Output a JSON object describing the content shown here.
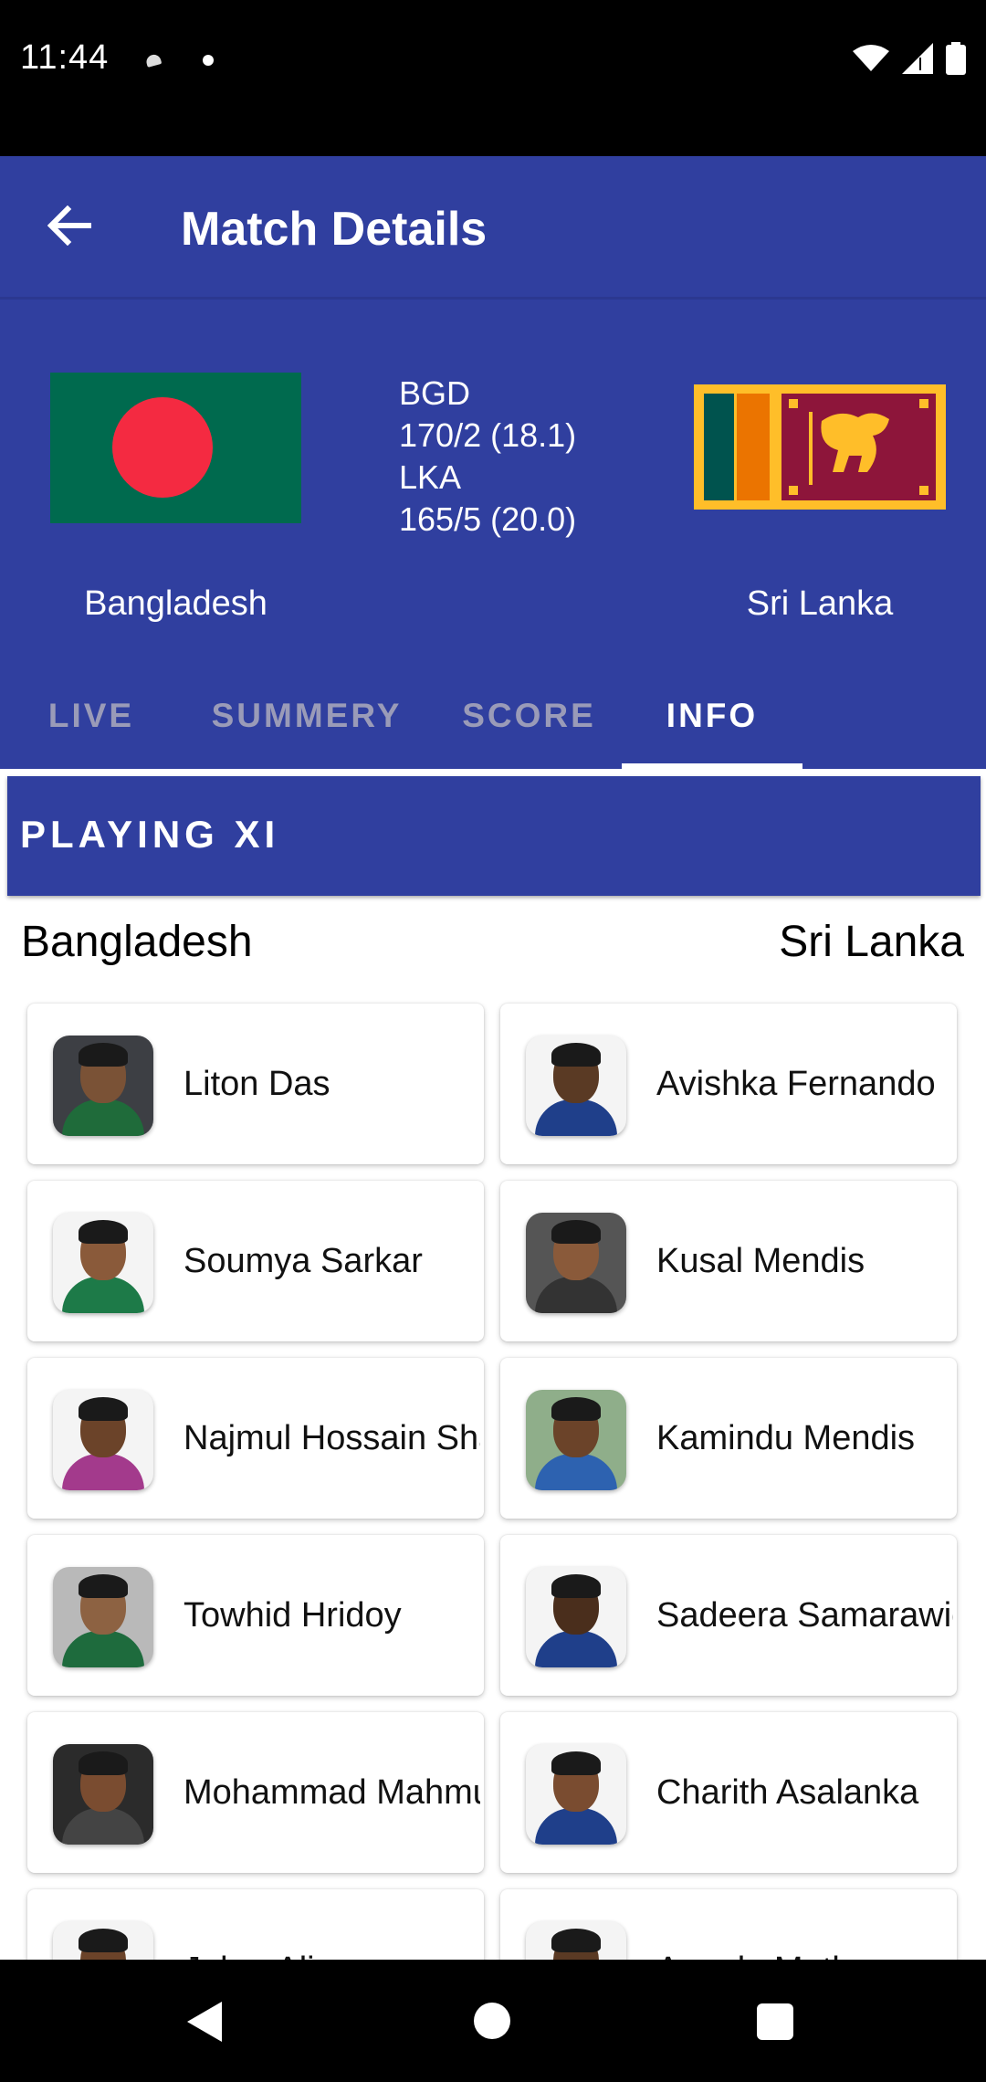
{
  "status_bar": {
    "time": "11:44"
  },
  "toolbar": {
    "title": "Match Details"
  },
  "match": {
    "team1": {
      "name": "Bangladesh",
      "code": "BGD",
      "score": "170/2 (18.1)"
    },
    "team2": {
      "name": "Sri Lanka",
      "code": "LKA",
      "score": "165/5 (20.0)"
    }
  },
  "tabs": [
    {
      "label": "LIVE",
      "active": false
    },
    {
      "label": "SUMMERY",
      "active": false
    },
    {
      "label": "SCORE",
      "active": false
    },
    {
      "label": "INFO",
      "active": true
    }
  ],
  "section": {
    "title": "PLAYING XI"
  },
  "columns": {
    "left": "Bangladesh",
    "right": "Sri Lanka"
  },
  "players_left": [
    "Liton Das",
    "Soumya Sarkar",
    "Najmul Hossain\nShanto",
    "Towhid Hridoy",
    "Mohammad\nMahmudullah",
    "Jaker Ali"
  ],
  "players_right": [
    "Avishka Fernando",
    "Kusal Mendis",
    "Kamindu Mendis",
    "Sadeera\nSamarawickrama",
    "Charith Asalanka",
    "Angelo Mathews"
  ],
  "colors": {
    "primary": "#303f9f",
    "bangladesh_green": "#006a4e",
    "bangladesh_red": "#f42a41",
    "srilanka_maroon": "#8d153a",
    "srilanka_gold": "#ffbe29"
  }
}
